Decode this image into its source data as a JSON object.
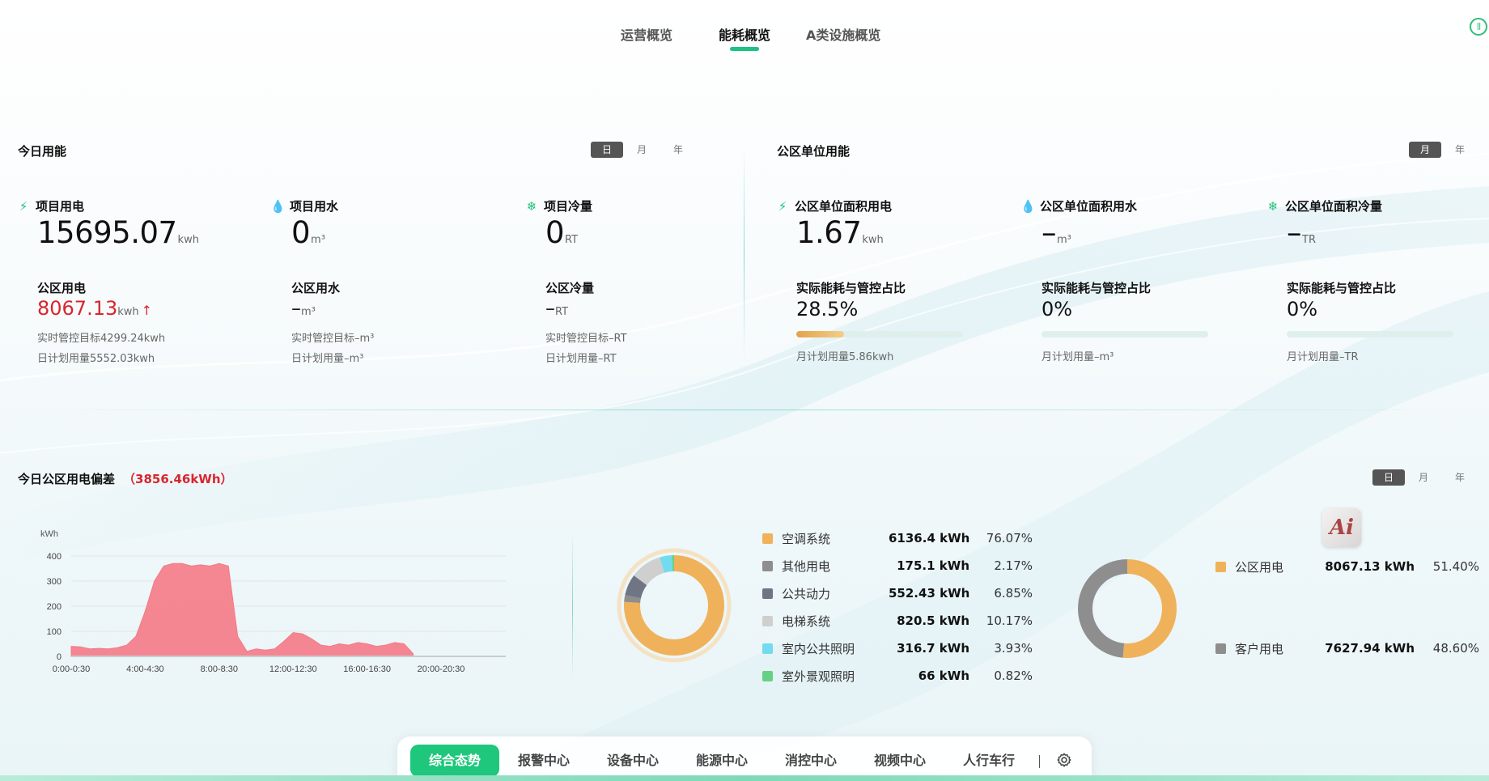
{
  "top_tabs": [
    {
      "label": "运营概览"
    },
    {
      "label": "能耗概览"
    },
    {
      "label": "A类设施概览"
    }
  ],
  "active_tab": "能耗概览",
  "today": {
    "title": "今日用能",
    "segments": [
      "日",
      "月",
      "年"
    ],
    "active_segment": "日",
    "cols": [
      {
        "label": "项目用电",
        "icon": "lightning-icon",
        "value": "15695.07",
        "unit": "kwh",
        "sub_label": "公区用电",
        "sub_value": "8067.13",
        "sub_unit": "kwh",
        "sub_trend": "↑",
        "target": "实时管控目标4299.24kwh",
        "plan": "日计划用量5552.03kwh"
      },
      {
        "label": "项目用水",
        "icon": "water-drop-icon",
        "value": "0",
        "unit": "m³",
        "sub_label": "公区用水",
        "sub_value": "–",
        "sub_unit": "m³",
        "target": "实时管控目标–m³",
        "plan": "日计划用量–m³"
      },
      {
        "label": "项目冷量",
        "icon": "snowflake-icon",
        "value": "0",
        "unit": "RT",
        "sub_label": "公区冷量",
        "sub_value": "–",
        "sub_unit": "RT",
        "target": "实时管控目标–RT",
        "plan": "日计划用量–RT"
      }
    ]
  },
  "unit": {
    "title": "公区单位用能",
    "segments": [
      "月",
      "年"
    ],
    "active_segment": "月",
    "cols": [
      {
        "label": "公区单位面积用电",
        "icon": "lightning-icon",
        "value": "1.67",
        "unit": "kwh",
        "ratio_label": "实际能耗与管控占比",
        "ratio": "28.5%",
        "ratio_value": 28.5,
        "plan": "月计划用量5.86kwh"
      },
      {
        "label": "公区单位面积用水",
        "icon": "water-drop-icon",
        "value": "–",
        "unit": "m³",
        "ratio_label": "实际能耗与管控占比",
        "ratio": "0%",
        "ratio_value": 0,
        "plan": "月计划用量–m³"
      },
      {
        "label": "公区单位面积冷量",
        "icon": "snowflake-icon",
        "value": "–",
        "unit": "TR",
        "ratio_label": "实际能耗与管控占比",
        "ratio": "0%",
        "ratio_value": 0,
        "plan": "月计划用量–TR"
      }
    ]
  },
  "deviation": {
    "title": "今日公区用电偏差",
    "value": "（3856.46kWh）",
    "segments": [
      "日",
      "月",
      "年"
    ],
    "active_segment": "日"
  },
  "chart_data": [
    {
      "type": "area",
      "ylabel": "kWh",
      "ylim": [
        0,
        400
      ],
      "yticks": [
        0,
        100,
        200,
        300,
        400
      ],
      "xtick_labels": [
        "0:00-0:30",
        "4:00-4:30",
        "8:00-8:30",
        "12:00-12:30",
        "16:00-16:30",
        "20:00-20:30"
      ],
      "color": "#f47a86",
      "values": [
        40,
        38,
        30,
        32,
        30,
        35,
        45,
        80,
        180,
        300,
        360,
        370,
        370,
        360,
        365,
        360,
        370,
        360,
        80,
        20,
        30,
        25,
        30,
        60,
        95,
        90,
        70,
        45,
        40,
        50,
        45,
        55,
        50,
        40,
        45,
        55,
        50,
        10,
        0,
        0,
        0,
        0,
        0,
        0,
        0,
        0,
        0,
        0
      ]
    },
    {
      "type": "pie",
      "style": "donut",
      "slices": [
        {
          "name": "空调系统",
          "value": "6136.4 kWh",
          "percent": "76.07%",
          "pct": 76.07,
          "color": "#efb25a"
        },
        {
          "name": "其他用电",
          "value": "175.1 kWh",
          "percent": "2.17%",
          "pct": 2.17,
          "color": "#8e8e8e"
        },
        {
          "name": "公共动力",
          "value": "552.43 kWh",
          "percent": "6.85%",
          "pct": 6.85,
          "color": "#6f7585"
        },
        {
          "name": "电梯系统",
          "value": "820.5 kWh",
          "percent": "10.17%",
          "pct": 10.17,
          "color": "#cfcfcf"
        },
        {
          "name": "室内公共照明",
          "value": "316.7 kWh",
          "percent": "3.93%",
          "pct": 3.93,
          "color": "#72dcef"
        },
        {
          "name": "室外景观照明",
          "value": "66 kWh",
          "percent": "0.82%",
          "pct": 0.82,
          "color": "#66d186"
        }
      ]
    },
    {
      "type": "pie",
      "style": "donut",
      "slices": [
        {
          "name": "公区用电",
          "value": "8067.13 kWh",
          "percent": "51.40%",
          "pct": 51.4,
          "color": "#efb25a"
        },
        {
          "name": "客户用电",
          "value": "7627.94 kWh",
          "percent": "48.60%",
          "pct": 48.6,
          "color": "#8e8e8e"
        }
      ]
    }
  ],
  "ai_badge": "Ai",
  "bottom_nav": [
    {
      "label": "综合态势"
    },
    {
      "label": "报警中心"
    },
    {
      "label": "设备中心"
    },
    {
      "label": "能源中心"
    },
    {
      "label": "消控中心"
    },
    {
      "label": "视频中心"
    },
    {
      "label": "人行车行"
    }
  ],
  "active_nav": "综合态势"
}
